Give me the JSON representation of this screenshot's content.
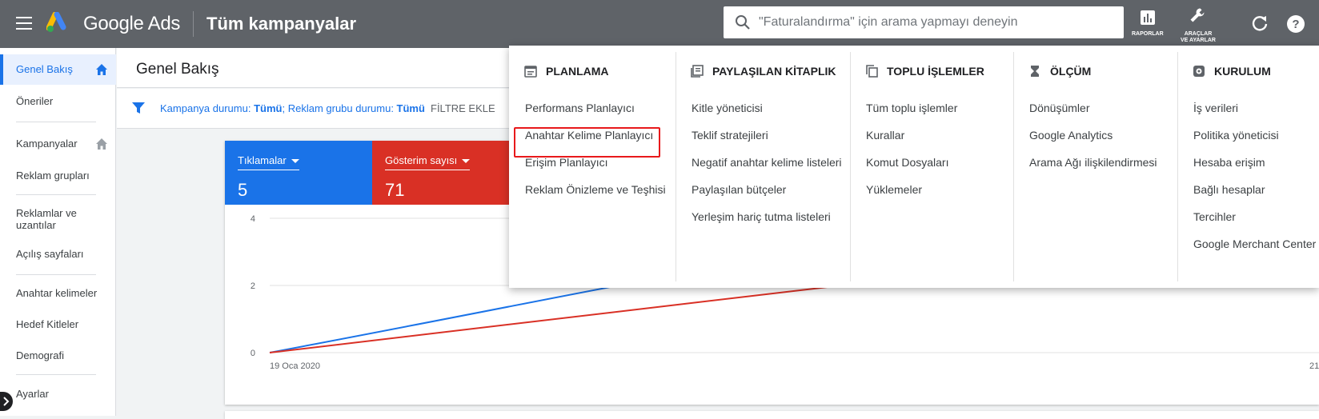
{
  "header": {
    "brand": "Google Ads",
    "page_title": "Tüm kampanyalar",
    "search_placeholder": "\"Faturalandırma\" için arama yapmayı deneyin",
    "reports_label": "RAPORLAR",
    "tools_label_line1": "ARAÇLAR",
    "tools_label_line2": "VE AYARLAR"
  },
  "sidebar": {
    "items": [
      {
        "label": "Genel Bakış"
      },
      {
        "label": "Öneriler"
      },
      {
        "label": "Kampanyalar"
      },
      {
        "label": "Reklam grupları"
      },
      {
        "label": "Reklamlar ve uzantılar"
      },
      {
        "label": "Açılış sayfaları"
      },
      {
        "label": "Anahtar kelimeler"
      },
      {
        "label": "Hedef Kitleler"
      },
      {
        "label": "Demografi"
      },
      {
        "label": "Ayarlar"
      }
    ]
  },
  "main": {
    "title": "Genel Bakış",
    "filter": {
      "campaign_status_label": "Kampanya durumu: ",
      "campaign_status_value": "Tümü",
      "sep": "; ",
      "adgroup_status_label": "Reklam grubu durumu: ",
      "adgroup_status_value": "Tümü",
      "add_filter": "FİLTRE EKLE"
    },
    "metrics": [
      {
        "label": "Tıklamalar",
        "value": "5",
        "color": "#1a73e8"
      },
      {
        "label": "Gösterim sayısı",
        "value": "71",
        "color": "#d93025"
      }
    ]
  },
  "chart_data": {
    "type": "line",
    "x_start_label": "19 Oca 2020",
    "x_end_label": "21",
    "y_ticks": [
      "4",
      "2",
      "0"
    ],
    "ylim": [
      0,
      4
    ],
    "series": [
      {
        "name": "Tıklamalar",
        "color": "#1a73e8"
      },
      {
        "name": "Gösterim sayısı",
        "color": "#d93025"
      }
    ]
  },
  "dropdown": {
    "columns": [
      {
        "header": "PLANLAMA",
        "icon": "calendar-icon",
        "items": [
          "Performans Planlayıcı",
          "Anahtar Kelime Planlayıcı",
          "Erişim Planlayıcı",
          "Reklam Önizleme ve Teşhisi"
        ]
      },
      {
        "header": "PAYLAŞILAN KİTAPLIK",
        "icon": "library-icon",
        "items": [
          "Kitle yöneticisi",
          "Teklif stratejileri",
          "Negatif anahtar kelime listeleri",
          "Paylaşılan bütçeler",
          "Yerleşim hariç tutma listeleri"
        ]
      },
      {
        "header": "TOPLU İŞLEMLER",
        "icon": "copy-icon",
        "items": [
          "Tüm toplu işlemler",
          "Kurallar",
          "Komut Dosyaları",
          "Yüklemeler"
        ]
      },
      {
        "header": "ÖLÇÜM",
        "icon": "hourglass-icon",
        "items": [
          "Dönüşümler",
          "Google Analytics",
          "Arama Ağı ilişkilendirmesi"
        ]
      },
      {
        "header": "KURULUM",
        "icon": "settings-icon",
        "items": [
          "İş verileri",
          "Politika yöneticisi",
          "Hesaba erişim",
          "Bağlı hesaplar",
          "Tercihler",
          "Google Merchant Center"
        ]
      }
    ]
  }
}
